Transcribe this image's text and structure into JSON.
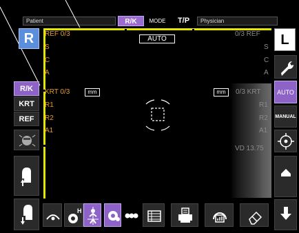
{
  "topbar": {
    "patient_label": "Patient",
    "physician_label": "Physician",
    "rk_button": "R/K",
    "mode_label": "MODE",
    "tp_button": "T/P"
  },
  "viewport": {
    "auto_label": "AUTO",
    "left": {
      "ref_count": "REF  0/3",
      "s": "S",
      "c": "C",
      "a": "A",
      "krt_count": "KRT  0/3",
      "mm": "mm",
      "r1": "R1",
      "r2": "R2",
      "a1": "A1"
    },
    "right": {
      "ref_count": "0/3  REF",
      "s": "S",
      "c": "C",
      "a": "A",
      "mm": "mm",
      "krt_count": "0/3  KRT",
      "r1": "R1",
      "r2": "R2",
      "a1": "A1",
      "vd": "VD 13.75"
    }
  },
  "left_column": {
    "eye_button": "R",
    "rk_button": "R/K",
    "krt_button": "KRT",
    "ref_button": "REF"
  },
  "right_column": {
    "eye_button": "L",
    "auto_button": "AUTO",
    "manual_button": "MANUAL"
  },
  "colors": {
    "accent_purple": "#8e63c8",
    "eye_blue": "#5b8fdc",
    "alignment_yellow": "#e6e600",
    "label_orange": "#e89c2a"
  }
}
